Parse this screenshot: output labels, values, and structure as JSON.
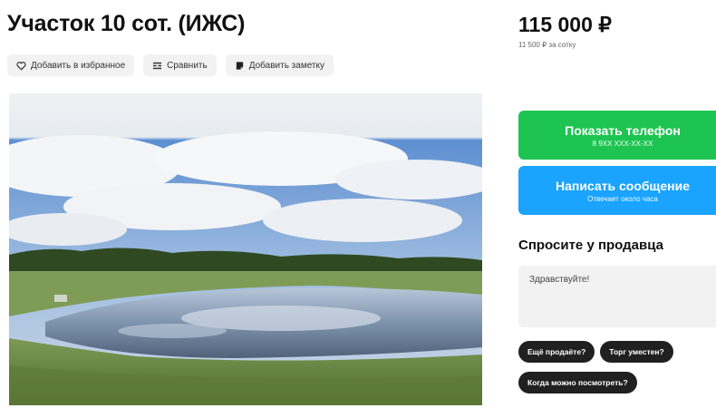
{
  "listing": {
    "title": "Участок 10 сот. (ИЖС)",
    "price": "115 000 ₽",
    "price_per_unit": "11 500 ₽ за сотку"
  },
  "actions": {
    "favorite": "Добавить в избранное",
    "compare": "Сравнить",
    "note": "Добавить заметку"
  },
  "contact": {
    "phone_label": "Показать телефон",
    "phone_masked": "8 9ХХ ХХХ-ХХ-ХХ",
    "message_label": "Написать сообщение",
    "message_sub": "Отвечает около часа"
  },
  "ask": {
    "title": "Спросите у продавца",
    "input_value": "Здравствуйте!",
    "chips": [
      "Ещё продаёте?",
      "Торг уместен?",
      "Когда можно посмотреть?"
    ]
  },
  "colors": {
    "phone_button": "#1ec451",
    "message_button": "#1aa3ff",
    "chip_bg": "#202020"
  },
  "icons": {
    "favorite": "heart-icon",
    "compare": "compare-icon",
    "note": "note-icon"
  }
}
